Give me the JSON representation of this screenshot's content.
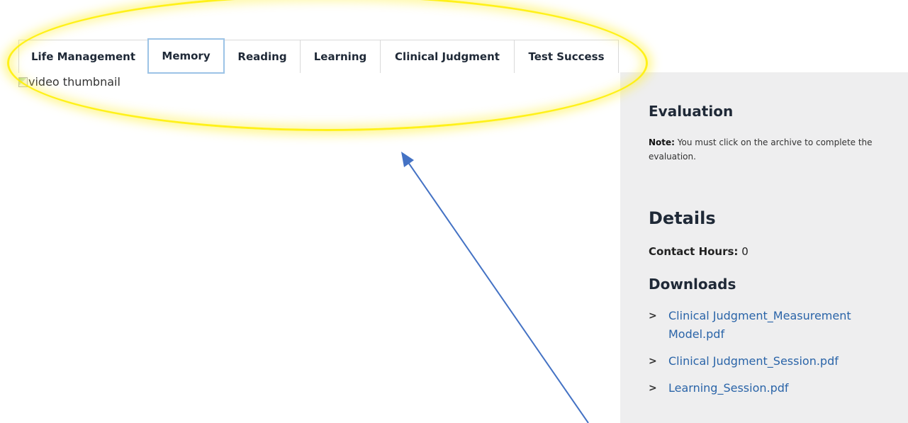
{
  "tabs": [
    {
      "label": "Life Management"
    },
    {
      "label": "Memory"
    },
    {
      "label": "Reading"
    },
    {
      "label": "Learning"
    },
    {
      "label": "Clinical Judgment"
    },
    {
      "label": "Test Success"
    }
  ],
  "active_tab": "Memory",
  "video": {
    "alt_text": "video thumbnail"
  },
  "sidebar": {
    "evaluation_title": "Evaluation",
    "note_label": "Note:",
    "note_text": "You must click on the archive to complete the evaluation.",
    "details_title": "Details",
    "contact_hours_label": "Contact Hours:",
    "contact_hours_value": "0",
    "downloads_title": "Downloads",
    "downloads": [
      {
        "label": "Clinical Judgment_Measurement Model.pdf"
      },
      {
        "label": "Clinical Judgment_Session.pdf"
      },
      {
        "label": "Learning_Session.pdf"
      }
    ]
  },
  "annotation": {
    "highlight_color": "#fff000",
    "arrow_color": "#4472c4"
  }
}
